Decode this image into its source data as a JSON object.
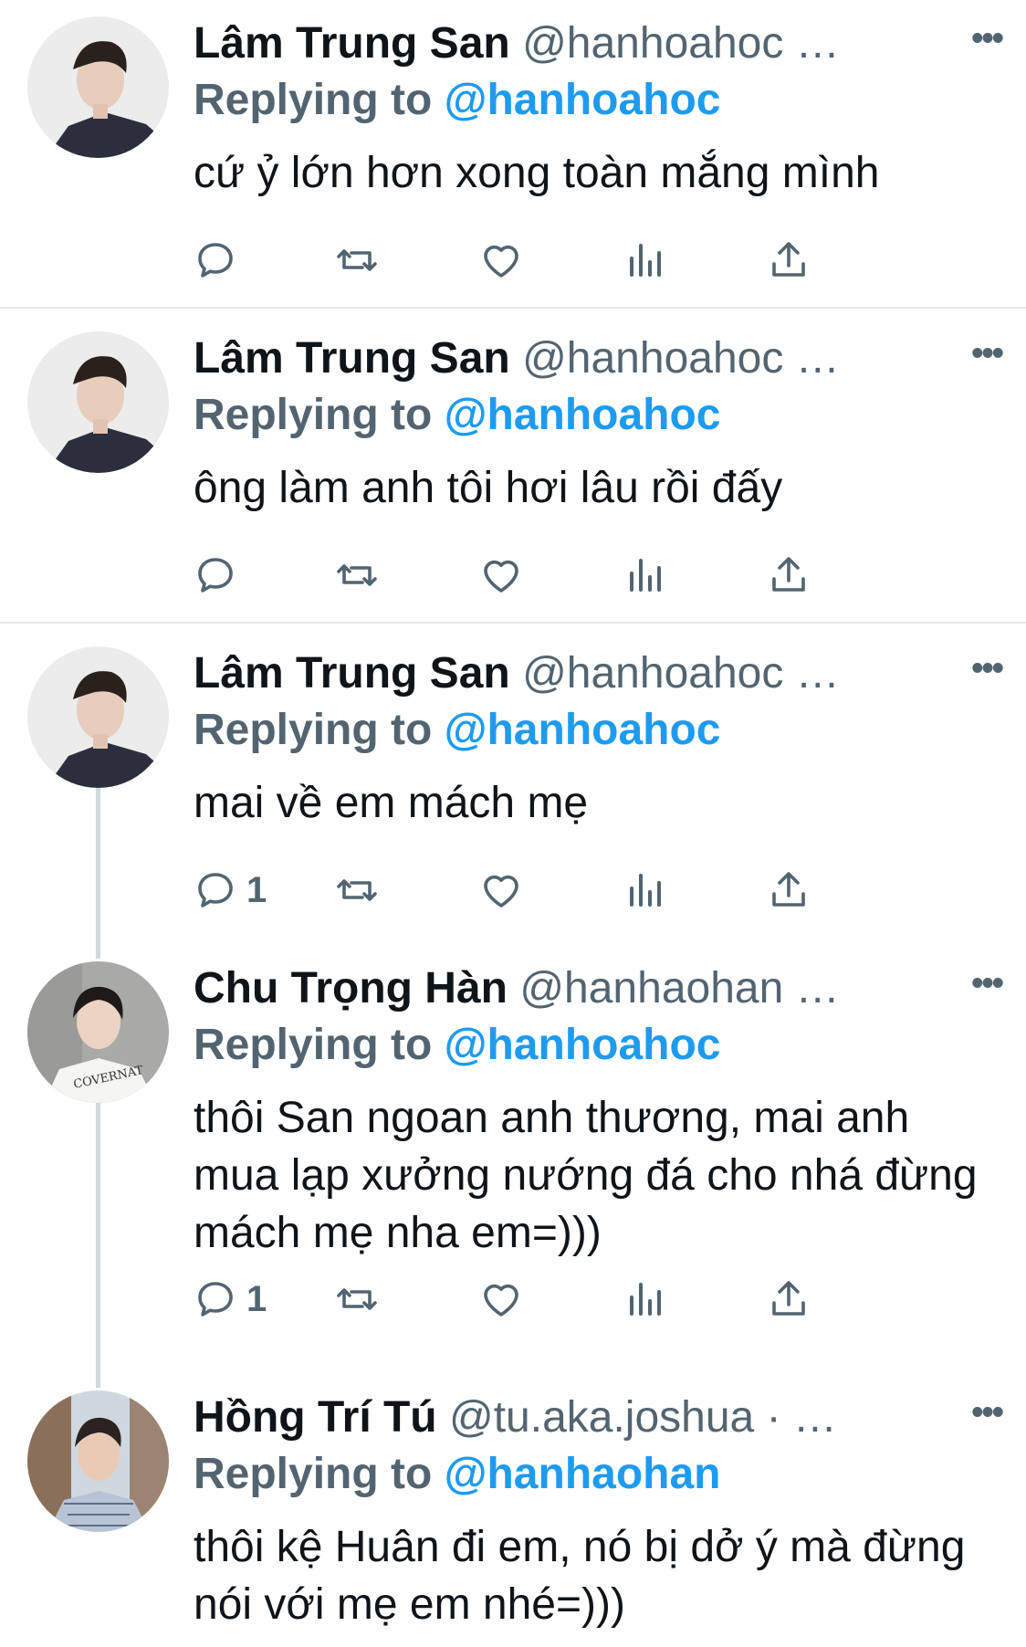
{
  "tweets": [
    {
      "name": "Lâm Trung San",
      "handle": "@hanhoahoc",
      "more": "•••",
      "reply_prefix": "Replying to",
      "reply_to": "@hanhoahoc",
      "text": "cứ ỷ lớn hơn xong toàn mắng mình",
      "reply_count": ""
    },
    {
      "name": "Lâm Trung San",
      "handle": "@hanhoahoc",
      "more": "•••",
      "reply_prefix": "Replying to",
      "reply_to": "@hanhoahoc",
      "text": "ông làm anh tôi hơi lâu rồi đấy",
      "reply_count": ""
    },
    {
      "name": "Lâm Trung San",
      "handle": "@hanhoahoc",
      "more": "•••",
      "reply_prefix": "Replying to",
      "reply_to": "@hanhoahoc",
      "text": "mai về em mách mẹ",
      "reply_count": "1"
    },
    {
      "name": "Chu Trọng Hàn",
      "handle": "@hanhaohan",
      "more": "•••",
      "reply_prefix": "Replying to",
      "reply_to": "@hanhoahoc",
      "text": "thôi San ngoan anh thương, mai anh mua lạp xưởng nướng đá cho nhá đừng mách mẹ nha em=)))",
      "reply_count": "1",
      "avatar_shirt_text": "COVERNAT"
    },
    {
      "name": "Hồng Trí Tú",
      "handle": "@tu.aka.joshua",
      "more": "•••",
      "reply_prefix": "Replying to",
      "reply_to": "@hanhaohan",
      "text": "thôi kệ Huân đi em, nó bị dở ý mà đừng nói với mẹ em nhé=)))",
      "reply_count": ""
    }
  ],
  "ellipsis": "…",
  "handle_dot": " ·",
  "icons": [
    "reply-icon",
    "retweet-icon",
    "like-icon",
    "analytics-icon",
    "share-icon"
  ],
  "colors": {
    "link": "#1d9bf0",
    "muted": "#536471",
    "text": "#0f1419",
    "divider": "#e6e6e6",
    "thread_line": "#cfd9de"
  }
}
